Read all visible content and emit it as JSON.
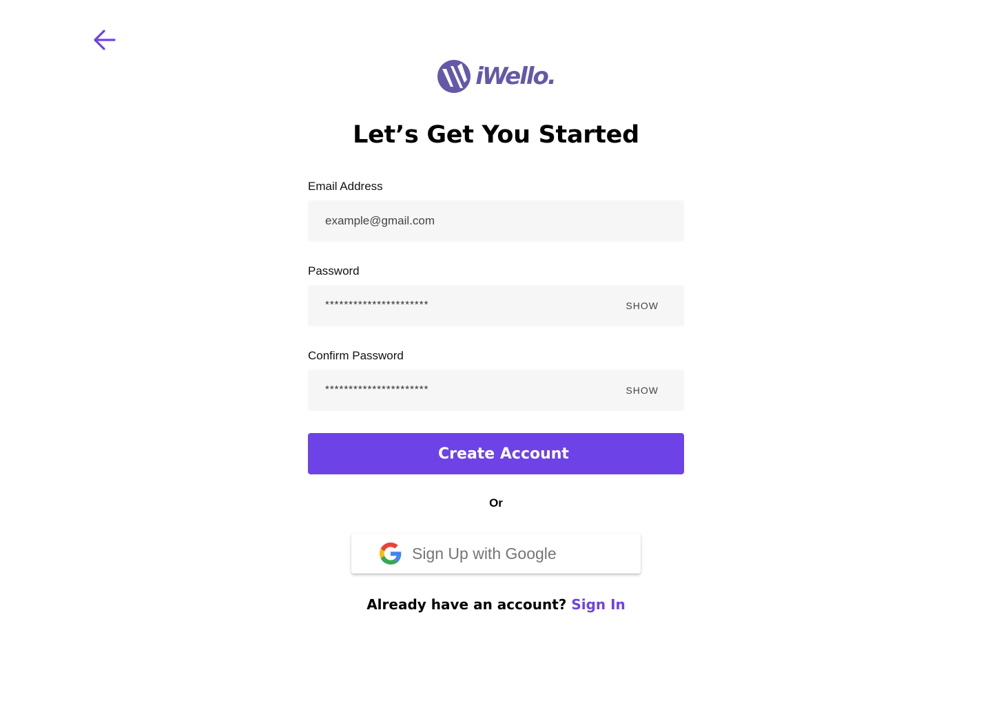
{
  "brand": {
    "name": "iWello.",
    "color": "#6558a8"
  },
  "nav": {
    "back_icon": "arrow-left-icon"
  },
  "title": "Let’s Get You Started",
  "form": {
    "email": {
      "label": "Email Address",
      "placeholder": "example@gmail.com"
    },
    "password": {
      "label": "Password",
      "value": "**********************",
      "toggle": "SHOW"
    },
    "confirm_password": {
      "label": "Confirm Password",
      "value": "**********************",
      "toggle": "SHOW"
    },
    "submit_label": "Create Account"
  },
  "divider": "Or",
  "google": {
    "label": "Sign Up with Google",
    "icon": "google-g-icon"
  },
  "footer": {
    "question": "Already have an account?",
    "link_label": "Sign In"
  },
  "colors": {
    "accent": "#6d42e6",
    "input_bg": "#f6f6f6"
  }
}
